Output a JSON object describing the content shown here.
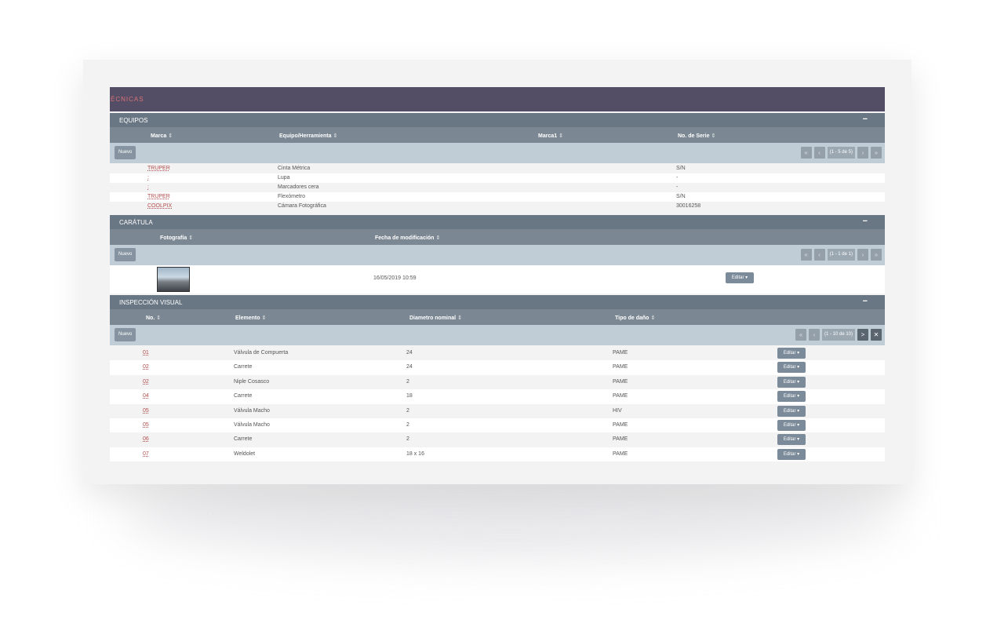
{
  "topbar": {
    "title": "ÉCNICAS"
  },
  "equipos": {
    "title": "EQUIPOS",
    "collapse": "−",
    "columns": [
      "Marca",
      "Equipo/Herramienta",
      "Marca1",
      "No. de Serie"
    ],
    "new_label": "Nuevo",
    "pager_info": "(1 - 5 de 5)",
    "rows": [
      {
        "marca": "TRUPER",
        "equipo": "Cinta Métrica",
        "serie": "S/N"
      },
      {
        "marca": ":",
        "equipo": "Lupa",
        "serie": "-"
      },
      {
        "marca": ":",
        "equipo": "Marcadores cera",
        "serie": "-"
      },
      {
        "marca": "TRUPER",
        "equipo": "Flexómetro",
        "serie": "S/N"
      },
      {
        "marca": "COOLPIX",
        "equipo": "Cámara Fotográfica",
        "serie": "30016258"
      }
    ]
  },
  "caratula": {
    "title": "CARÁTULA",
    "collapse": "−",
    "columns": [
      "Fotografía",
      "Fecha de modificación"
    ],
    "new_label": "Nuevo",
    "pager_info": "(1 - 1 de 1)",
    "rows": [
      {
        "fecha": "16/05/2019 10:59",
        "edit": "Editar ▾"
      }
    ]
  },
  "inspeccion": {
    "title": "INSPECCIÓN VISUAL",
    "collapse": "−",
    "columns": [
      "No.",
      "Elemento",
      "Diametro nominal",
      "Tipo de daño"
    ],
    "new_label": "Nuevo",
    "pager_info": "(1 - 10 de 10)",
    "rows": [
      {
        "no": "01",
        "elemento": "Válvula de Compuerta",
        "diametro": "24",
        "tipo": "PAME",
        "edit": "Editar ▾"
      },
      {
        "no": "02",
        "elemento": "Carrete",
        "diametro": "24",
        "tipo": "PAME",
        "edit": "Editar ▾"
      },
      {
        "no": "02",
        "elemento": "Niple Cosasco",
        "diametro": "2",
        "tipo": "PAME",
        "edit": "Editar ▾"
      },
      {
        "no": "04",
        "elemento": "Carrete",
        "diametro": "18",
        "tipo": "PAME",
        "edit": "Editar ▾"
      },
      {
        "no": "05",
        "elemento": "Válvula Macho",
        "diametro": "2",
        "tipo": "HIV",
        "edit": "Editar ▾"
      },
      {
        "no": "05",
        "elemento": "Válvula Macho",
        "diametro": "2",
        "tipo": "PAME",
        "edit": "Editar ▾"
      },
      {
        "no": "06",
        "elemento": "Carrete",
        "diametro": "2",
        "tipo": "PAME",
        "edit": "Editar ▾"
      },
      {
        "no": "07",
        "elemento": "Weldolet",
        "diametro": "18 x 16",
        "tipo": "PAME",
        "edit": "Editar ▾"
      }
    ]
  },
  "icons": {
    "sort": "⇕",
    "first": "«",
    "prev": "‹",
    "next": "›",
    "last": "»",
    "next_active": ">",
    "last_active": "✕"
  }
}
